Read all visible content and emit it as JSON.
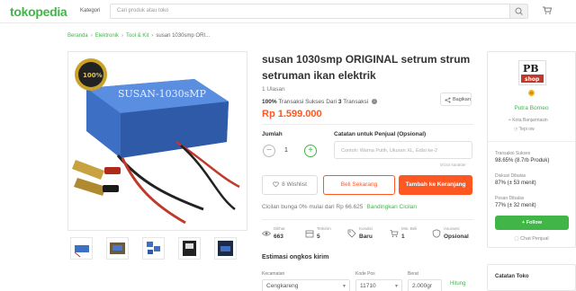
{
  "header": {
    "logo": "tokopedia",
    "kategori": "Kategori",
    "search_placeholder": "Cari produk atau toko",
    "colors": {
      "brand": "#42b549",
      "accent": "#ff5722"
    }
  },
  "breadcrumb": [
    "Beranda",
    "Elektronik",
    "Tool & Kit",
    "susan 1030smp ORI..."
  ],
  "product": {
    "title_line1": "susan 1030smp ORIGINAL setrum strum",
    "title_line2": "setruman ikan elektrik",
    "ulasan": "1 Ulasan",
    "transaksi_pct": "100%",
    "transaksi_text_1": "Transaksi Sukses Dari",
    "transaksi_count": "3",
    "transaksi_text_2": "Transaksi",
    "bagikan": "Bagikan",
    "price": "Rp 1.599.000",
    "image_label": "SUSAN-1030sMP",
    "image_badge": "100%"
  },
  "purchase": {
    "jumlah_label": "Jumlah",
    "quantity": "1",
    "catatan_label": "Catatan untuk Penjual (Opsional)",
    "catatan_placeholder": "Contoh: Warna Putih, Ukuran XL, Edisi ke-2",
    "char_count": "0/144 karakter",
    "wishlist": "8 Wishlist",
    "beli_sekarang": "Beli Sekarang",
    "tambah_keranjang": "Tambah ke Keranjang",
    "cicilan_text": "Cicilan bunga 0% mulai dari Rp 66.625",
    "cicilan_link": "Bandingkan Cicilan"
  },
  "stats": [
    {
      "label": "Dilihat",
      "value": "663",
      "icon": "eye-icon"
    },
    {
      "label": "Terkirim",
      "value": "5",
      "icon": "box-icon"
    },
    {
      "label": "Kondisi",
      "value": "Baru",
      "icon": "tag-icon"
    },
    {
      "label": "Min. Beli",
      "value": "1",
      "icon": "cart-icon"
    },
    {
      "label": "Asuransi",
      "value": "Opsional",
      "icon": "shield-icon"
    }
  ],
  "shipping": {
    "title": "Estimasi ongkos kirim",
    "kecamatan_label": "Kecamatan",
    "kecamatan_value": "Cengkareng",
    "kodepos_label": "Kode Pos",
    "kodepos_value": "11710",
    "berat_label": "Berat",
    "berat_value": "2.000gr",
    "hitung": "Hitung"
  },
  "shop": {
    "name": "Putra Borneo",
    "location": "Kota Banjarmasin",
    "online": "Tepi ow",
    "transaksi_label": "Transaksi Sukses",
    "transaksi_value": "98.65% (8.7rb Produk)",
    "diskusi_label": "Diskusi Dibalas",
    "diskusi_value": "87% (± 53 menit)",
    "pesan_label": "Pesan Dibalas",
    "pesan_value": "77% (± 32 menit)",
    "follow": "+ Follow",
    "chat": "Chat Penjual",
    "catatan_toko": "Catatan Toko",
    "logo_text_top": "PB",
    "logo_text_bottom": "shop"
  }
}
